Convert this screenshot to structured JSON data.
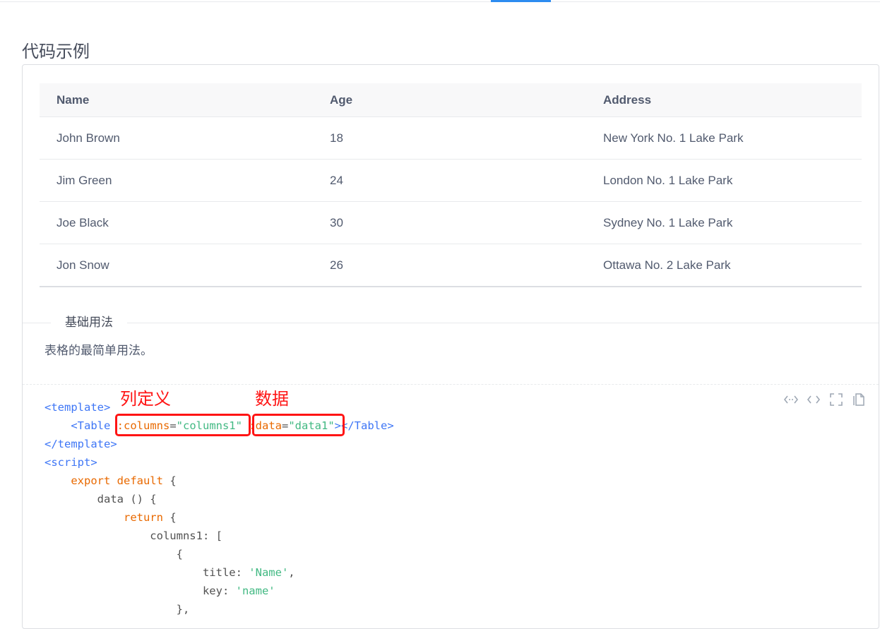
{
  "header": {
    "title": "代码示例",
    "active_tab_color": "#2d8cf0"
  },
  "table": {
    "columns": [
      "Name",
      "Age",
      "Address"
    ],
    "rows": [
      {
        "name": "John Brown",
        "age": "18",
        "address": "New York No. 1 Lake Park"
      },
      {
        "name": "Jim Green",
        "age": "24",
        "address": "London No. 1 Lake Park"
      },
      {
        "name": "Joe Black",
        "age": "30",
        "address": "Sydney No. 1 Lake Park"
      },
      {
        "name": "Jon Snow",
        "age": "26",
        "address": "Ottawa No. 2 Lake Park"
      }
    ]
  },
  "section": {
    "legend": "基础用法",
    "description": "表格的最简单用法。"
  },
  "toolbar": {
    "icons": [
      "code-expand-icon",
      "code-icon",
      "fullscreen-icon",
      "copy-icon"
    ]
  },
  "code": {
    "lines": [
      [
        {
          "t": "tag",
          "v": "<template>"
        }
      ],
      [
        {
          "t": "plain",
          "v": "    "
        },
        {
          "t": "tag",
          "v": "<Table "
        },
        {
          "t": "attr",
          "v": ":columns"
        },
        {
          "t": "plain",
          "v": "="
        },
        {
          "t": "str",
          "v": "\"columns1\""
        },
        {
          "t": "plain",
          "v": " "
        },
        {
          "t": "attr",
          "v": ":data"
        },
        {
          "t": "plain",
          "v": "="
        },
        {
          "t": "str",
          "v": "\"data1\""
        },
        {
          "t": "tag",
          "v": "></Table>"
        }
      ],
      [
        {
          "t": "tag",
          "v": "</template>"
        }
      ],
      [
        {
          "t": "tag",
          "v": "<script>"
        }
      ],
      [
        {
          "t": "plain",
          "v": "    "
        },
        {
          "t": "kw",
          "v": "export default"
        },
        {
          "t": "plain",
          "v": " {"
        }
      ],
      [
        {
          "t": "plain",
          "v": "        data () {"
        }
      ],
      [
        {
          "t": "plain",
          "v": "            "
        },
        {
          "t": "kw",
          "v": "return"
        },
        {
          "t": "plain",
          "v": " {"
        }
      ],
      [
        {
          "t": "plain",
          "v": "                columns1: ["
        }
      ],
      [
        {
          "t": "plain",
          "v": "                    {"
        }
      ],
      [
        {
          "t": "plain",
          "v": "                        title: "
        },
        {
          "t": "str",
          "v": "'Name'"
        },
        {
          "t": "plain",
          "v": ","
        }
      ],
      [
        {
          "t": "plain",
          "v": "                        key: "
        },
        {
          "t": "str",
          "v": "'name'"
        }
      ],
      [
        {
          "t": "plain",
          "v": "                    },"
        }
      ]
    ]
  },
  "annotations": {
    "columns_label": "列定义",
    "data_label": "数据",
    "color": "#ff1414"
  }
}
